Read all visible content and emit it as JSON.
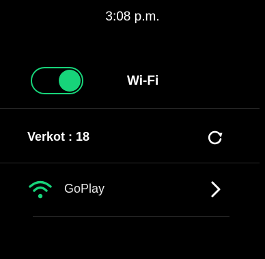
{
  "status_bar": {
    "time": "3:08 p.m."
  },
  "wifi": {
    "title": "Wi-Fi",
    "enabled": true,
    "accent_color": "#17d47a"
  },
  "networks": {
    "count_label": "Verkot : 18",
    "refresh_icon": "refresh-icon"
  },
  "network_list": [
    {
      "name": "GoPlay",
      "signal_icon": "wifi-signal-icon",
      "chevron_icon": "chevron-right-icon"
    }
  ]
}
